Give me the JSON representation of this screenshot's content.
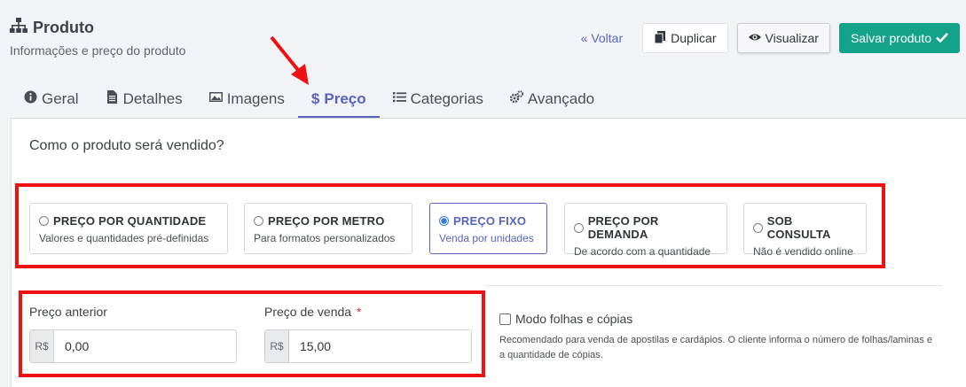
{
  "header": {
    "title": "Produto",
    "subtitle": "Informações e preço do produto",
    "back_label": "« Voltar",
    "duplicate_label": "Duplicar",
    "view_label": "Visualizar",
    "save_label": "Salvar produto"
  },
  "tabs": [
    {
      "label": "Geral",
      "icon": "info-circle-icon",
      "active": false
    },
    {
      "label": "Detalhes",
      "icon": "document-icon",
      "active": false
    },
    {
      "label": "Imagens",
      "icon": "image-icon",
      "active": false
    },
    {
      "label": "Preço",
      "icon": "dollar-icon",
      "active": true
    },
    {
      "label": "Categorias",
      "icon": "list-icon",
      "active": false
    },
    {
      "label": "Avançado",
      "icon": "gears-icon",
      "active": false
    }
  ],
  "pricing": {
    "question": "Como o produto será vendido?",
    "options": [
      {
        "title": "PREÇO POR QUANTIDADE",
        "subtitle": "Valores e quantidades pré-definidas",
        "selected": false
      },
      {
        "title": "PREÇO POR METRO",
        "subtitle": "Para formatos personalizados",
        "selected": false
      },
      {
        "title": "PREÇO FIXO",
        "subtitle": "Venda por unidades",
        "selected": true
      },
      {
        "title": "PREÇO POR DEMANDA",
        "subtitle": "De acordo com a quantidade",
        "selected": false
      },
      {
        "title": "SOB CONSULTA",
        "subtitle": "Não é vendido online",
        "selected": false
      }
    ],
    "previous_price": {
      "label": "Preço anterior",
      "prefix": "R$",
      "value": "0,00"
    },
    "sale_price": {
      "label": "Preço de venda",
      "required_mark": "*",
      "prefix": "R$",
      "value": "15,00"
    },
    "sheets_mode": {
      "label": "Modo folhas e cópias",
      "checked": false,
      "help": "Recomendado para venda de apostilas e cardápios. O cliente informa o número de folhas/laminas e a quantidade de cópias."
    }
  },
  "colors": {
    "accent": "#5664c0",
    "success": "#14a28a",
    "highlight": "#ee1111"
  }
}
